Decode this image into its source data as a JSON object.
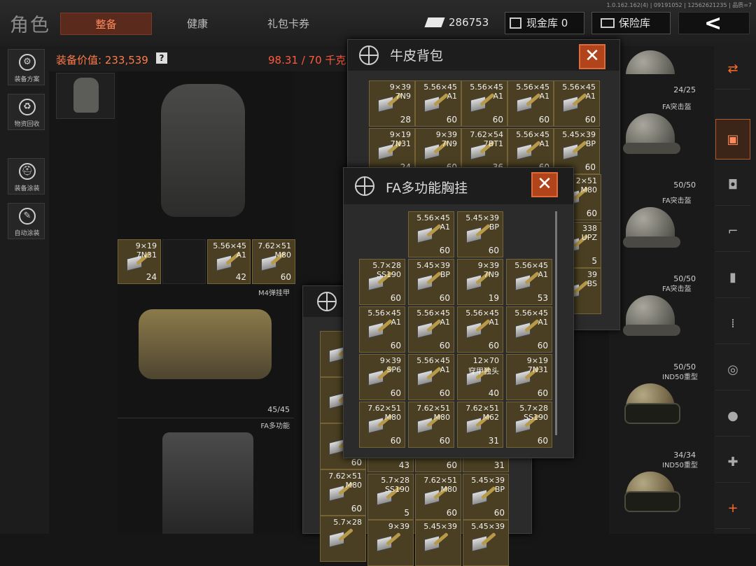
{
  "header": {
    "title": "角色",
    "tabs": [
      "整备",
      "健康",
      "礼包卡券"
    ],
    "version": "1.0.162.162(4) | 09191052 | 12562621235 | 品质=7",
    "cash": "286753",
    "vault_label": "现金库 0",
    "safe_label": "保险库",
    "back_icon": "back-arrow-icon"
  },
  "leftbar": {
    "items": [
      "装备方案",
      "物资回收",
      "装备涂装",
      "自动涂装"
    ]
  },
  "equip": {
    "value_label": "装备价值: 233,539",
    "help": "?",
    "weight": "98.31 / 70 千克"
  },
  "gear": {
    "vest_name": "M4弹挂甲",
    "vest_dur": "45/45",
    "rig_name": "FA多功能"
  },
  "belt_slots": [
    {
      "cal": "9×19",
      "var": "7N31",
      "n": "24"
    },
    {
      "cal": "",
      "var": "",
      "n": ""
    },
    {
      "cal": "5.56×45",
      "var": "A1",
      "n": "42"
    },
    {
      "cal": "7.62×51",
      "var": "M80",
      "n": "60"
    }
  ],
  "right": {
    "items": [
      {
        "name": "",
        "dur": "24/25"
      },
      {
        "name": "FA突击盔",
        "dur": "50/50"
      },
      {
        "name": "FA突击盔",
        "dur": "50/50"
      },
      {
        "name": "FA突击盔",
        "dur": "50/50"
      },
      {
        "name": "IND50重型",
        "dur": "34/34"
      },
      {
        "name": "IND50重型",
        "dur": ""
      }
    ]
  },
  "backpack": {
    "title": "牛皮背包",
    "row1": [
      {
        "cal": "9×39",
        "var": "7N9",
        "n": "28"
      },
      {
        "cal": "5.56×45",
        "var": "A1",
        "n": "60"
      },
      {
        "cal": "5.56×45",
        "var": "A1",
        "n": "60"
      },
      {
        "cal": "5.56×45",
        "var": "A1",
        "n": "60"
      },
      {
        "cal": "5.56×45",
        "var": "A1",
        "n": "60"
      }
    ],
    "row2": [
      {
        "cal": "9×19",
        "var": "7N31",
        "n": "24"
      },
      {
        "cal": "9×39",
        "var": "7N9",
        "n": "60"
      },
      {
        "cal": "7.62×54",
        "var": "7BT1",
        "n": "36"
      },
      {
        "cal": "5.56×45",
        "var": "A1",
        "n": "60"
      },
      {
        "cal": "5.45×39",
        "var": "BP",
        "n": "60"
      }
    ],
    "peek": [
      {
        "cal": "2×51",
        "var": "M80",
        "n": "60"
      },
      {
        "cal": "338",
        "var": "UPZ",
        "n": "5"
      },
      {
        "cal": "39",
        "var": "BS",
        "n": ""
      }
    ]
  },
  "rig": {
    "title": "FA多功能胸挂",
    "rows": [
      [
        {
          "cal": "5.56×45",
          "var": "A1",
          "n": "60"
        },
        {
          "cal": "5.45×39",
          "var": "BP",
          "n": "60"
        }
      ],
      [
        {
          "cal": "5.7×28",
          "var": "SS190",
          "n": "60"
        },
        {
          "cal": "5.45×39",
          "var": "BP",
          "n": "60"
        },
        {
          "cal": "9×39",
          "var": "7N9",
          "n": "19"
        },
        {
          "cal": "5.56×45",
          "var": "A1",
          "n": "53"
        }
      ],
      [
        {
          "cal": "5.56×45",
          "var": "A1",
          "n": "60"
        },
        {
          "cal": "5.56×45",
          "var": "A1",
          "n": "60"
        },
        {
          "cal": "5.56×45",
          "var": "A1",
          "n": "60"
        },
        {
          "cal": "5.56×45",
          "var": "A1",
          "n": "60"
        }
      ],
      [
        {
          "cal": "9×39",
          "var": "SP6",
          "n": "60"
        },
        {
          "cal": "5.56×45",
          "var": "A1",
          "n": "60"
        },
        {
          "cal": "12×70",
          "var": "穿甲独头",
          "n": "40"
        },
        {
          "cal": "9×19",
          "var": "7N31",
          "n": "60"
        }
      ],
      [
        {
          "cal": "7.62×51",
          "var": "M80",
          "n": "60"
        },
        {
          "cal": "7.62×51",
          "var": "M80",
          "n": "60"
        },
        {
          "cal": "7.62×51",
          "var": "M62",
          "n": "31"
        },
        {
          "cal": "5.7×28",
          "var": "SS190",
          "n": "60"
        }
      ]
    ]
  },
  "bottom": {
    "left": [
      {
        "cal": "7.62",
        "var": "",
        "n": ""
      },
      {
        "cal": "7.62",
        "var": "",
        "n": ""
      },
      {
        "cal": "7.62",
        "var": "",
        "n": "60"
      },
      {
        "cal": "7.62×51",
        "var": "M80",
        "n": "60"
      },
      {
        "cal": "5.7×28",
        "var": "",
        "n": ""
      }
    ],
    "row_a": [
      {
        "cal": "",
        "var": "",
        "n": "43"
      },
      {
        "cal": "",
        "var": "",
        "n": "60"
      },
      {
        "cal": "",
        "var": "",
        "n": "31"
      }
    ],
    "row_b": [
      {
        "cal": "5.7×28",
        "var": "SS190",
        "n": "5"
      },
      {
        "cal": "7.62×51",
        "var": "M80",
        "n": "60"
      },
      {
        "cal": "5.45×39",
        "var": "BP",
        "n": "60"
      }
    ],
    "row_c": [
      {
        "cal": "9×39",
        "var": "",
        "n": ""
      },
      {
        "cal": "5.45×39",
        "var": "",
        "n": ""
      },
      {
        "cal": "5.45×39",
        "var": "",
        "n": ""
      }
    ]
  },
  "categories": [
    "gear-swap-icon",
    "backpack-icon",
    "armor-vest-icon",
    "rifle-icon",
    "magazine-icon",
    "ammo-icon",
    "scope-icon",
    "grenade-icon",
    "medkit-icon",
    "add-icon"
  ]
}
